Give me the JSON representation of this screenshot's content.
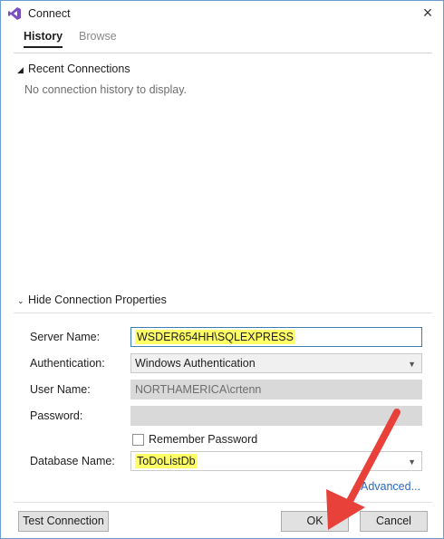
{
  "window": {
    "title": "Connect"
  },
  "tabs": [
    {
      "label": "History",
      "active": true
    },
    {
      "label": "Browse",
      "active": false
    }
  ],
  "recent": {
    "header": "Recent Connections",
    "empty_text": "No connection history to display."
  },
  "properties": {
    "header": "Hide Connection Properties",
    "server_name": {
      "label": "Server Name:",
      "value": "WSDER654HH\\SQLEXPRESS"
    },
    "authentication": {
      "label": "Authentication:",
      "value": "Windows Authentication"
    },
    "user_name": {
      "label": "User Name:",
      "value": "NORTHAMERICA\\crtenn"
    },
    "password": {
      "label": "Password:",
      "value": ""
    },
    "remember_password": {
      "label": "Remember Password",
      "checked": false
    },
    "database_name": {
      "label": "Database Name:",
      "value": "ToDoListDb"
    },
    "advanced_link": "Advanced..."
  },
  "buttons": {
    "test_connection": "Test Connection",
    "ok": "OK",
    "cancel": "Cancel"
  },
  "colors": {
    "highlight": "#ffff66",
    "annotation_arrow": "#e8413a",
    "link": "#2b6ac2"
  },
  "icons": {
    "app": "visual-studio-icon",
    "close": "close-icon",
    "collapse_recent": "triangle-up-icon",
    "collapse_props": "chevron-down-icon"
  }
}
